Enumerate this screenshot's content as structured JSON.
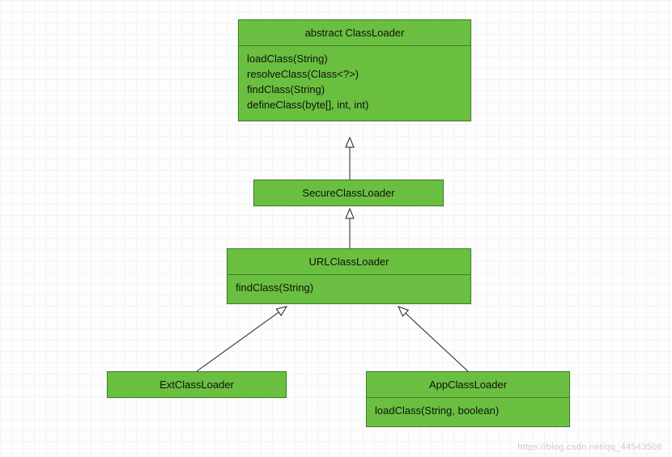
{
  "diagram": {
    "type": "uml-class-hierarchy",
    "colors": {
      "fill": "#6abf40",
      "border": "#3f7f28",
      "grid": "#f3f3f3",
      "bg": "#fdfdfd"
    },
    "classes": {
      "classloader": {
        "title": "abstract ClassLoader",
        "methods": [
          "loadClass(String)",
          "resolveClass(Class<?>)",
          "findClass(String)",
          "defineClass(byte[], int, int)"
        ]
      },
      "secure": {
        "title": "SecureClassLoader",
        "methods": []
      },
      "url": {
        "title": "URLClassLoader",
        "methods": [
          "findClass(String)"
        ]
      },
      "ext": {
        "title": "ExtClassLoader",
        "methods": []
      },
      "app": {
        "title": "AppClassLoader",
        "methods": [
          "loadClass(String, boolean)"
        ]
      }
    },
    "edges": [
      {
        "from": "secure",
        "to": "classloader",
        "kind": "generalization"
      },
      {
        "from": "url",
        "to": "secure",
        "kind": "generalization"
      },
      {
        "from": "ext",
        "to": "url",
        "kind": "generalization"
      },
      {
        "from": "app",
        "to": "url",
        "kind": "generalization"
      }
    ]
  },
  "watermark": "https://blog.csdn.net/qq_44543508"
}
